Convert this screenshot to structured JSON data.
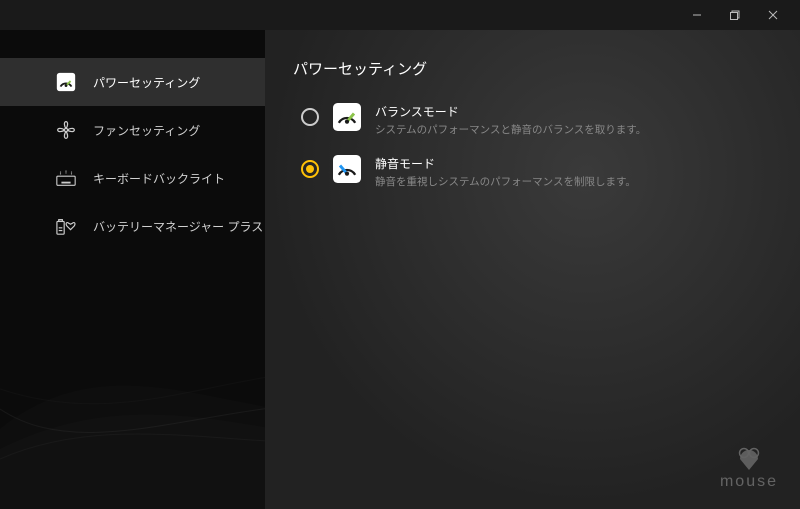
{
  "window": {
    "minimize": "—",
    "maximize": "❐",
    "close": "✕"
  },
  "sidebar": {
    "items": [
      {
        "label": "パワーセッティング"
      },
      {
        "label": "ファンセッティング"
      },
      {
        "label": "キーボードバックライト"
      },
      {
        "label": "バッテリーマネージャー プラス"
      }
    ]
  },
  "main": {
    "title": "パワーセッティング",
    "modes": [
      {
        "title": "バランスモード",
        "desc": "システムのパフォーマンスと静音のバランスを取ります。",
        "selected": false
      },
      {
        "title": "静音モード",
        "desc": "静音を重視しシステムのパフォーマンスを制限します。",
        "selected": true
      }
    ]
  },
  "brand": "mouse"
}
